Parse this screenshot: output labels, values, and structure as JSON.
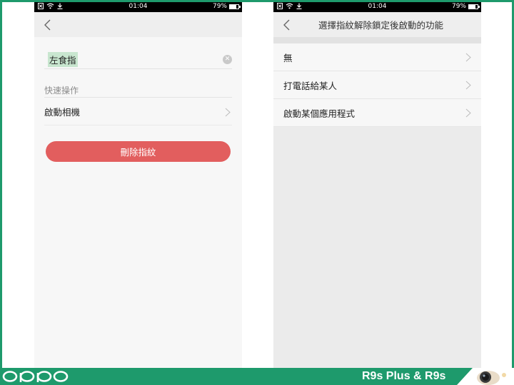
{
  "left_screen": {
    "status": {
      "time": "01:04",
      "battery": "79%",
      "battery_level": 0.79
    },
    "fingerprint_name": "左食指",
    "section_label": "快速操作",
    "quick_action_label": "啟動相機",
    "delete_button_label": "刪除指紋"
  },
  "right_screen": {
    "status": {
      "time": "01:04",
      "battery": "79%",
      "battery_level": 0.79
    },
    "title": "選擇指紋解除鎖定後啟動的功能",
    "options": [
      {
        "label": "無"
      },
      {
        "label": "打電話給某人"
      },
      {
        "label": "啟動某個應用程式"
      }
    ]
  },
  "footer": {
    "brand": "oppo",
    "model_text": "R9s Plus & R9s",
    "brand_color": "#1e9a6c"
  },
  "colors": {
    "delete_button": "#e25e5e",
    "highlight": "#c8e6cf"
  }
}
